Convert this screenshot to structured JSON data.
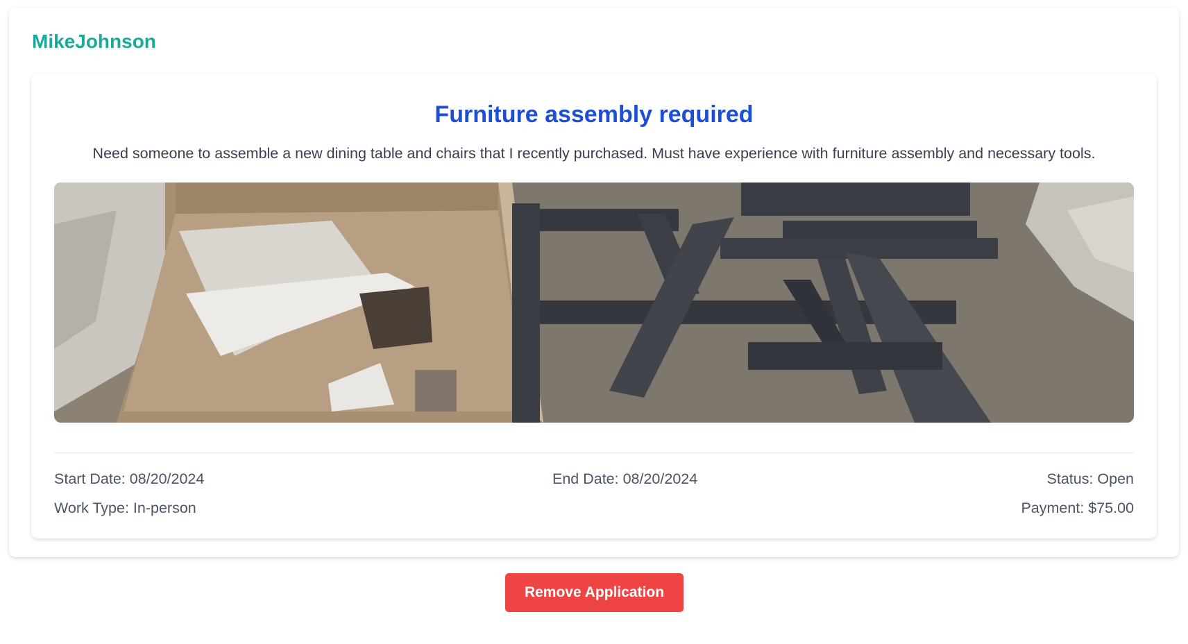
{
  "poster": {
    "username": "MikeJohnson"
  },
  "job": {
    "title": "Furniture assembly required",
    "description": "Need someone to assemble a new dining table and chairs that I recently purchased. Must have experience with furniture assembly and necessary tools.",
    "image_subject": "unassembled furniture parts and cardboard box on floor",
    "start_date": "Start Date: 08/20/2024",
    "end_date": "End Date: 08/20/2024",
    "status": "Status: Open",
    "work_type": "Work Type: In-person",
    "payment": "Payment: $75.00"
  },
  "actions": {
    "remove_label": "Remove Application"
  },
  "colors": {
    "username": "#1ba99a",
    "title": "#1d4ed8",
    "remove_button": "#ef4444"
  }
}
